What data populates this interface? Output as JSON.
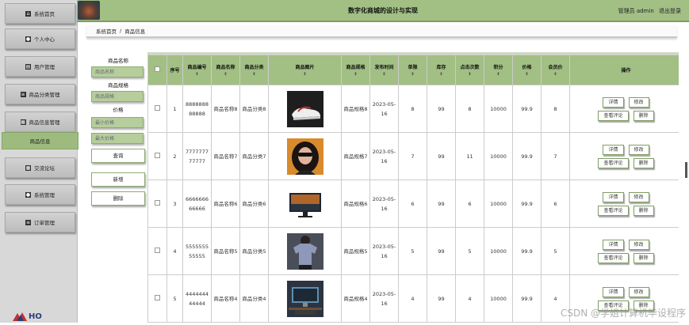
{
  "app": {
    "title": "数字化商城的设计与实现",
    "admin_label": "管理员 admin",
    "logout": "退出登录"
  },
  "sidebar": {
    "items": [
      {
        "label": "系统首页",
        "icon": "home-icon"
      },
      {
        "label": "个人中心",
        "icon": "person-icon"
      },
      {
        "label": "用户管理",
        "icon": "user-list-icon"
      },
      {
        "label": "商品分类管理",
        "icon": "menu-icon"
      },
      {
        "label": "商品信息管理",
        "icon": "grid-icon"
      },
      {
        "label": "商品信息",
        "icon": "",
        "active": true
      },
      {
        "label": "交流论坛",
        "icon": "grid-icon"
      },
      {
        "label": "系统管理",
        "icon": "person-icon"
      },
      {
        "label": "订单管理",
        "icon": "menu-icon"
      }
    ],
    "logo_text": "HO"
  },
  "breadcrumb": {
    "home": "系统首页",
    "sep": "/",
    "current": "商品信息"
  },
  "filter": {
    "name_label": "商品名称",
    "name_placeholder": "商品名称",
    "spec_label": "商品规格",
    "spec_placeholder": "商品规格",
    "price_label": "价格",
    "min_price_placeholder": "最小价格",
    "max_price_placeholder": "最大价格",
    "search": "查询",
    "add": "新增",
    "delete": "删除"
  },
  "table": {
    "headers": [
      "序号",
      "商品编号",
      "商品名称",
      "商品分类",
      "商品图片",
      "商品规格",
      "发布时间",
      "单限",
      "库存",
      "点击次数",
      "积分",
      "价格",
      "会员价",
      "操作"
    ],
    "sort_glyph": "⇕",
    "actions": {
      "detail": "详情",
      "edit": "修改",
      "comments": "查看评论",
      "delete": "删除"
    },
    "rows": [
      {
        "idx": "1",
        "code": "888888888888",
        "name": "商品名称8",
        "category": "商品分类8",
        "image": "sneaker-photo",
        "spec": "商品规格8",
        "time": "2023-05-16",
        "limit": "8",
        "stock": "99",
        "clicks": "8",
        "points": "10000",
        "price": "99.9",
        "member_price": "8"
      },
      {
        "idx": "2",
        "code": "777777777777",
        "name": "商品名称7",
        "category": "商品分类7",
        "image": "woman-sunglasses-photo",
        "spec": "商品规格7",
        "time": "2023-05-16",
        "limit": "7",
        "stock": "99",
        "clicks": "11",
        "points": "10000",
        "price": "99.9",
        "member_price": "7"
      },
      {
        "idx": "3",
        "code": "666666666666",
        "name": "商品名称6",
        "category": "商品分类6",
        "image": "monitor-photo",
        "spec": "商品规格6",
        "time": "2023-05-16",
        "limit": "6",
        "stock": "99",
        "clicks": "6",
        "points": "10000",
        "price": "99.9",
        "member_price": "6"
      },
      {
        "idx": "4",
        "code": "555555555555",
        "name": "商品名称5",
        "category": "商品分类5",
        "image": "tshirt-model-photo",
        "spec": "商品规格5",
        "time": "2023-05-16",
        "limit": "5",
        "stock": "99",
        "clicks": "5",
        "points": "10000",
        "price": "99.9",
        "member_price": "5"
      },
      {
        "idx": "5",
        "code": "444444444444",
        "name": "商品名称4",
        "category": "商品分类4",
        "image": "desk-computer-photo",
        "spec": "商品规格4",
        "time": "2023-05-16",
        "limit": "4",
        "stock": "99",
        "clicks": "4",
        "points": "10000",
        "price": "99.9",
        "member_price": "4"
      }
    ]
  },
  "watermark": "CSDN @学姐计算机毕设程序"
}
